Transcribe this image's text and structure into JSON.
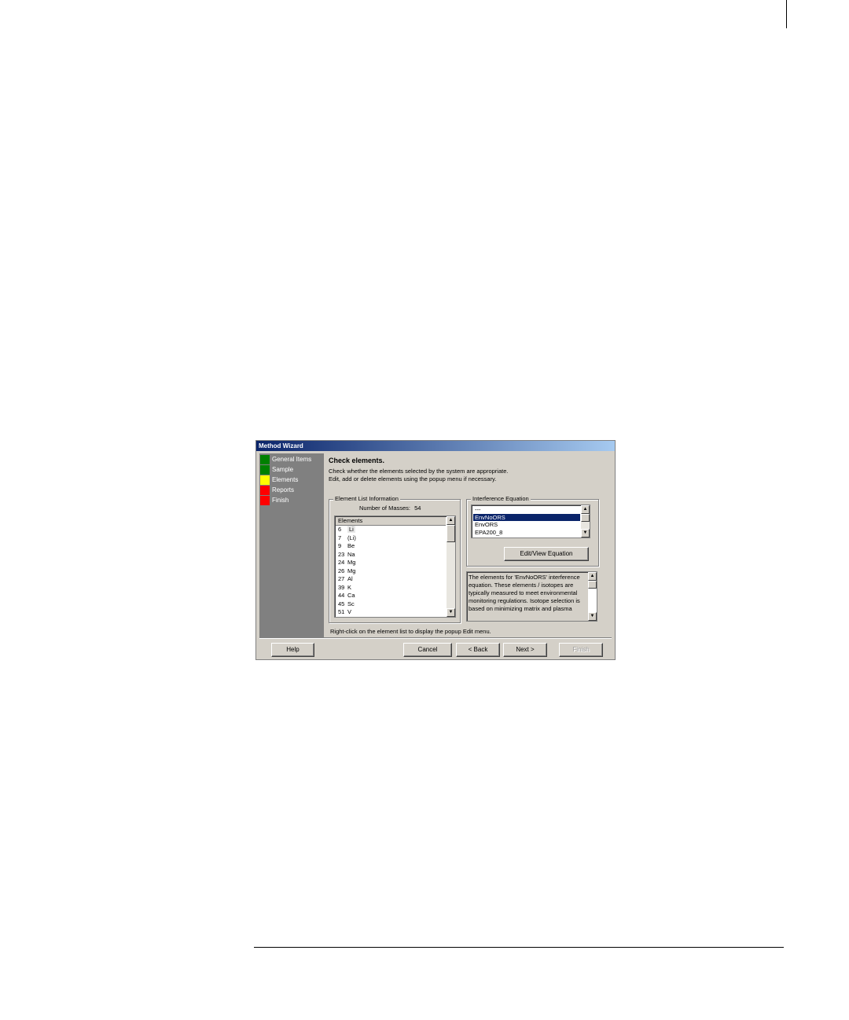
{
  "window": {
    "title": "Method Wizard"
  },
  "steps": [
    {
      "label": "General Items",
      "color": "#008000"
    },
    {
      "label": "Sample",
      "color": "#008000"
    },
    {
      "label": "Elements",
      "color": "#ffff00"
    },
    {
      "label": "Reports",
      "color": "#ff0000"
    },
    {
      "label": "Finish",
      "color": "#ff0000"
    }
  ],
  "main": {
    "heading": "Check elements.",
    "instruction_1": "Check whether the elements selected by the system are appropriate.",
    "instruction_2": "Edit, add or delete elements using the popup menu if necessary."
  },
  "element_list": {
    "group_label": "Element List Information",
    "masses_label": "Number of Masses:",
    "masses_count": "54",
    "column_header": "Elements",
    "rows": [
      {
        "mass": "6",
        "symbol": "Li"
      },
      {
        "mass": "7",
        "symbol": "(Li)"
      },
      {
        "mass": "9",
        "symbol": "Be"
      },
      {
        "mass": "23",
        "symbol": "Na"
      },
      {
        "mass": "24",
        "symbol": "Mg"
      },
      {
        "mass": "26",
        "symbol": "Mg"
      },
      {
        "mass": "27",
        "symbol": "Al"
      },
      {
        "mass": "39",
        "symbol": "K"
      },
      {
        "mass": "44",
        "symbol": "Ca"
      },
      {
        "mass": "45",
        "symbol": "Sc"
      },
      {
        "mass": "51",
        "symbol": "V"
      }
    ],
    "hint": "Right-click on the element list to display the popup Edit menu."
  },
  "interference": {
    "group_label": "Interference Equation",
    "items": [
      "---",
      "EnvNoORS",
      "EnvORS",
      "EPA200_8"
    ],
    "selected_index": 1,
    "edit_button": "Edit/View Equation",
    "description": "The elements for 'EnvNoORS' interference equation. These elements / isotopes are typically measured to meet environmental monitoring regulations. Isotope selection is based on minimizing matrix and plasma"
  },
  "buttons": {
    "help": "Help",
    "cancel": "Cancel",
    "back": "< Back",
    "next": "Next >",
    "finish": "Finish"
  }
}
